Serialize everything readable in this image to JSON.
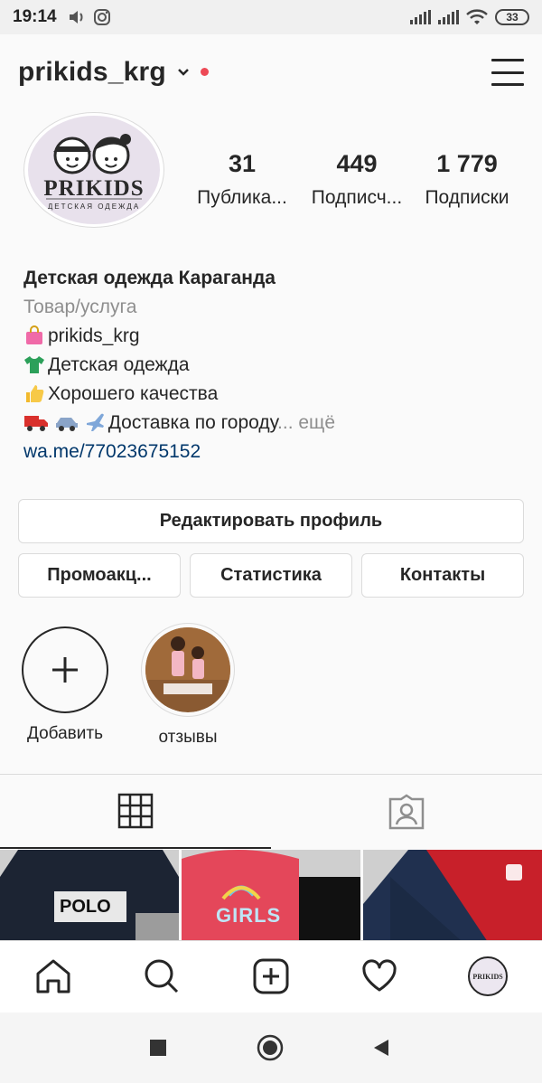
{
  "status_bar": {
    "time": "19:14",
    "battery": "33"
  },
  "header": {
    "username": "prikids_krg"
  },
  "avatar": {
    "brand": "PRIKIDS",
    "tagline": "ДЕТСКАЯ ОДЕЖДА"
  },
  "stats": [
    {
      "value": "31",
      "label": "Публика..."
    },
    {
      "value": "449",
      "label": "Подписч..."
    },
    {
      "value": "1 779",
      "label": "Подписки"
    }
  ],
  "bio": {
    "name": "Детская одежда Караганда",
    "category": "Товар/услуга",
    "lines": [
      "prikids_krg",
      "Детская одежда",
      "Хорошего качества",
      "Доставка по городу"
    ],
    "more": "... ещё",
    "link": "wa.me/77023675152"
  },
  "buttons": {
    "edit_profile": "Редактировать профиль",
    "promo": "Промоакц...",
    "stats": "Статистика",
    "contacts": "Контакты"
  },
  "highlights": [
    {
      "label": "Добавить"
    },
    {
      "label": "отзывы"
    }
  ],
  "grid": [
    {
      "label": "POLO"
    },
    {
      "label": "GIRLS"
    },
    {
      "label": ""
    }
  ],
  "bottom_nav": {
    "profile_badge": "PRIKIDS"
  },
  "colors": {
    "accent_red": "#ed4956",
    "link": "#00376b",
    "muted": "#8e8e8e",
    "border": "#dbdbdb"
  }
}
